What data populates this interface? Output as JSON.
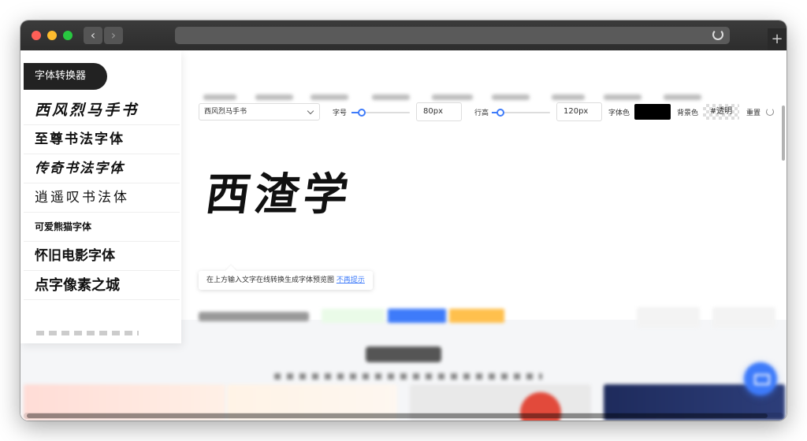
{
  "sidebar": {
    "title": "字体转换器",
    "items": [
      {
        "label": "西风烈马手书",
        "size": 19
      },
      {
        "label": "至尊书法字体",
        "size": 17
      },
      {
        "label": "传奇书法字体",
        "size": 17
      },
      {
        "label": "逍遥叹书法体",
        "size": 17
      },
      {
        "label": "可爱熊猫字体",
        "size": 12
      },
      {
        "label": "怀旧电影字体",
        "size": 17
      },
      {
        "label": "点字像素之城",
        "size": 18
      }
    ]
  },
  "toolbar": {
    "font_select": "西风烈马手书",
    "size_label": "字号",
    "size_value": "80px",
    "line_height_label": "行高",
    "line_height_value": "120px",
    "font_color_label": "字体色",
    "font_color": "#000000",
    "bg_color_label": "背景色",
    "bg_color_value": "#透明",
    "reset_label": "重置"
  },
  "preview": {
    "text": "西渣学"
  },
  "tip": {
    "text": "在上方输入文字在线转换生成字体预览图",
    "link": "不再提示"
  },
  "colors": {
    "accent": "#3e7bfa",
    "sidebar_head": "#222222"
  }
}
